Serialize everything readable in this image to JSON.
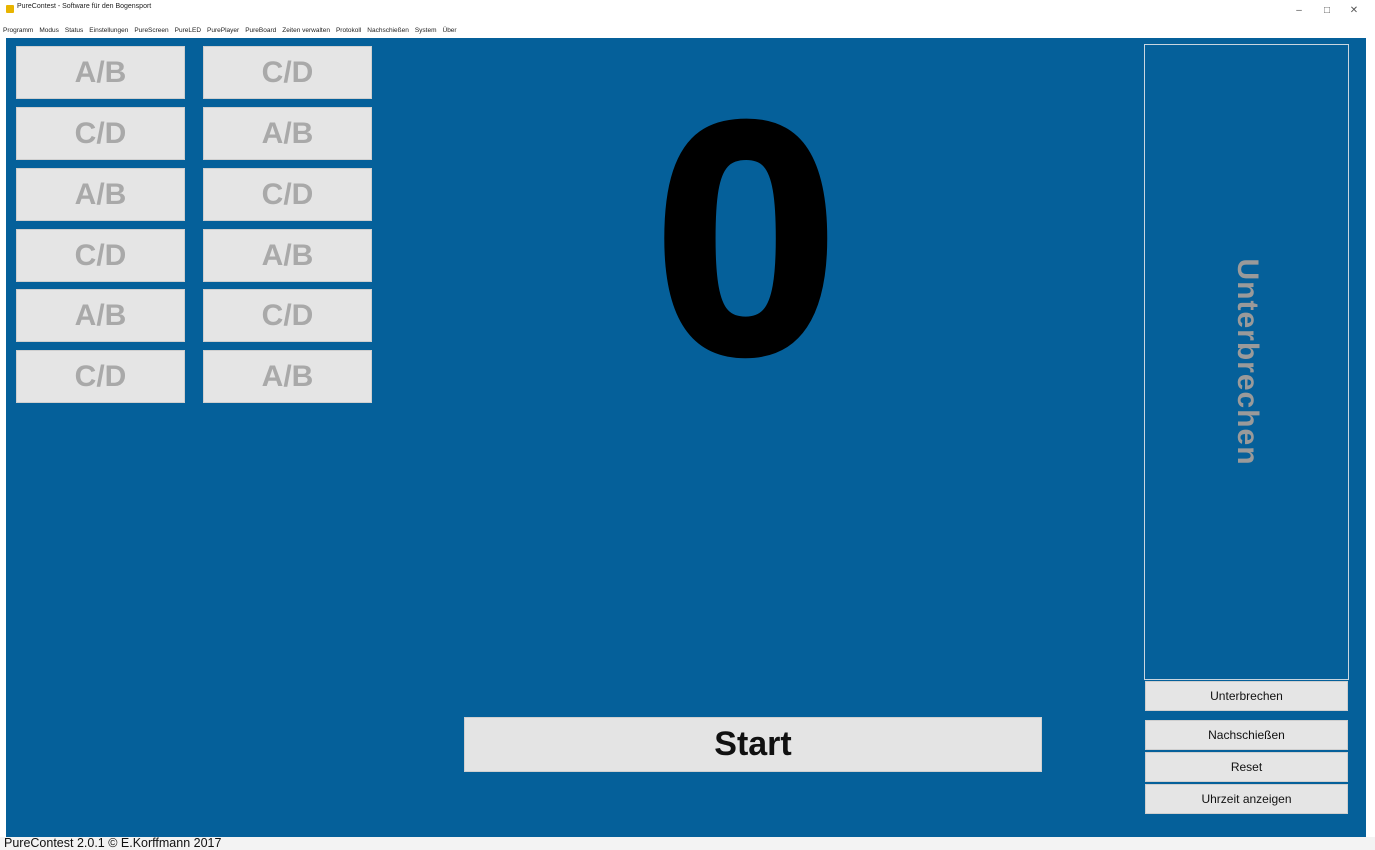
{
  "window": {
    "title": "PureContest - Software für den Bogensport",
    "minimize": "–",
    "maximize": "□",
    "close": "✕"
  },
  "menu": [
    "Programm",
    "Modus",
    "Status",
    "Einstellungen",
    "PureScreen",
    "PureLED",
    "PurePlayer",
    "PureBoard",
    "Zeiten verwalten",
    "Protokoll",
    "Nachschießen",
    "System",
    "Über"
  ],
  "groups": {
    "left": [
      "A/B",
      "C/D",
      "A/B",
      "C/D",
      "A/B",
      "C/D"
    ],
    "right": [
      "C/D",
      "A/B",
      "C/D",
      "A/B",
      "C/D",
      "A/B"
    ]
  },
  "counter": "0",
  "start_label": "Start",
  "big_pause_label": "Unterbrechen",
  "side_buttons": {
    "pause": "Unterbrechen",
    "reshoot": "Nachschießen",
    "reset": "Reset",
    "show_time": "Uhrzeit anzeigen"
  },
  "status": "PureContest 2.0.1 © E.Korffmann 2017",
  "colors": {
    "background": "#05609a",
    "button": "#e5e5e5",
    "button_text_muted": "#a9a9a9"
  }
}
